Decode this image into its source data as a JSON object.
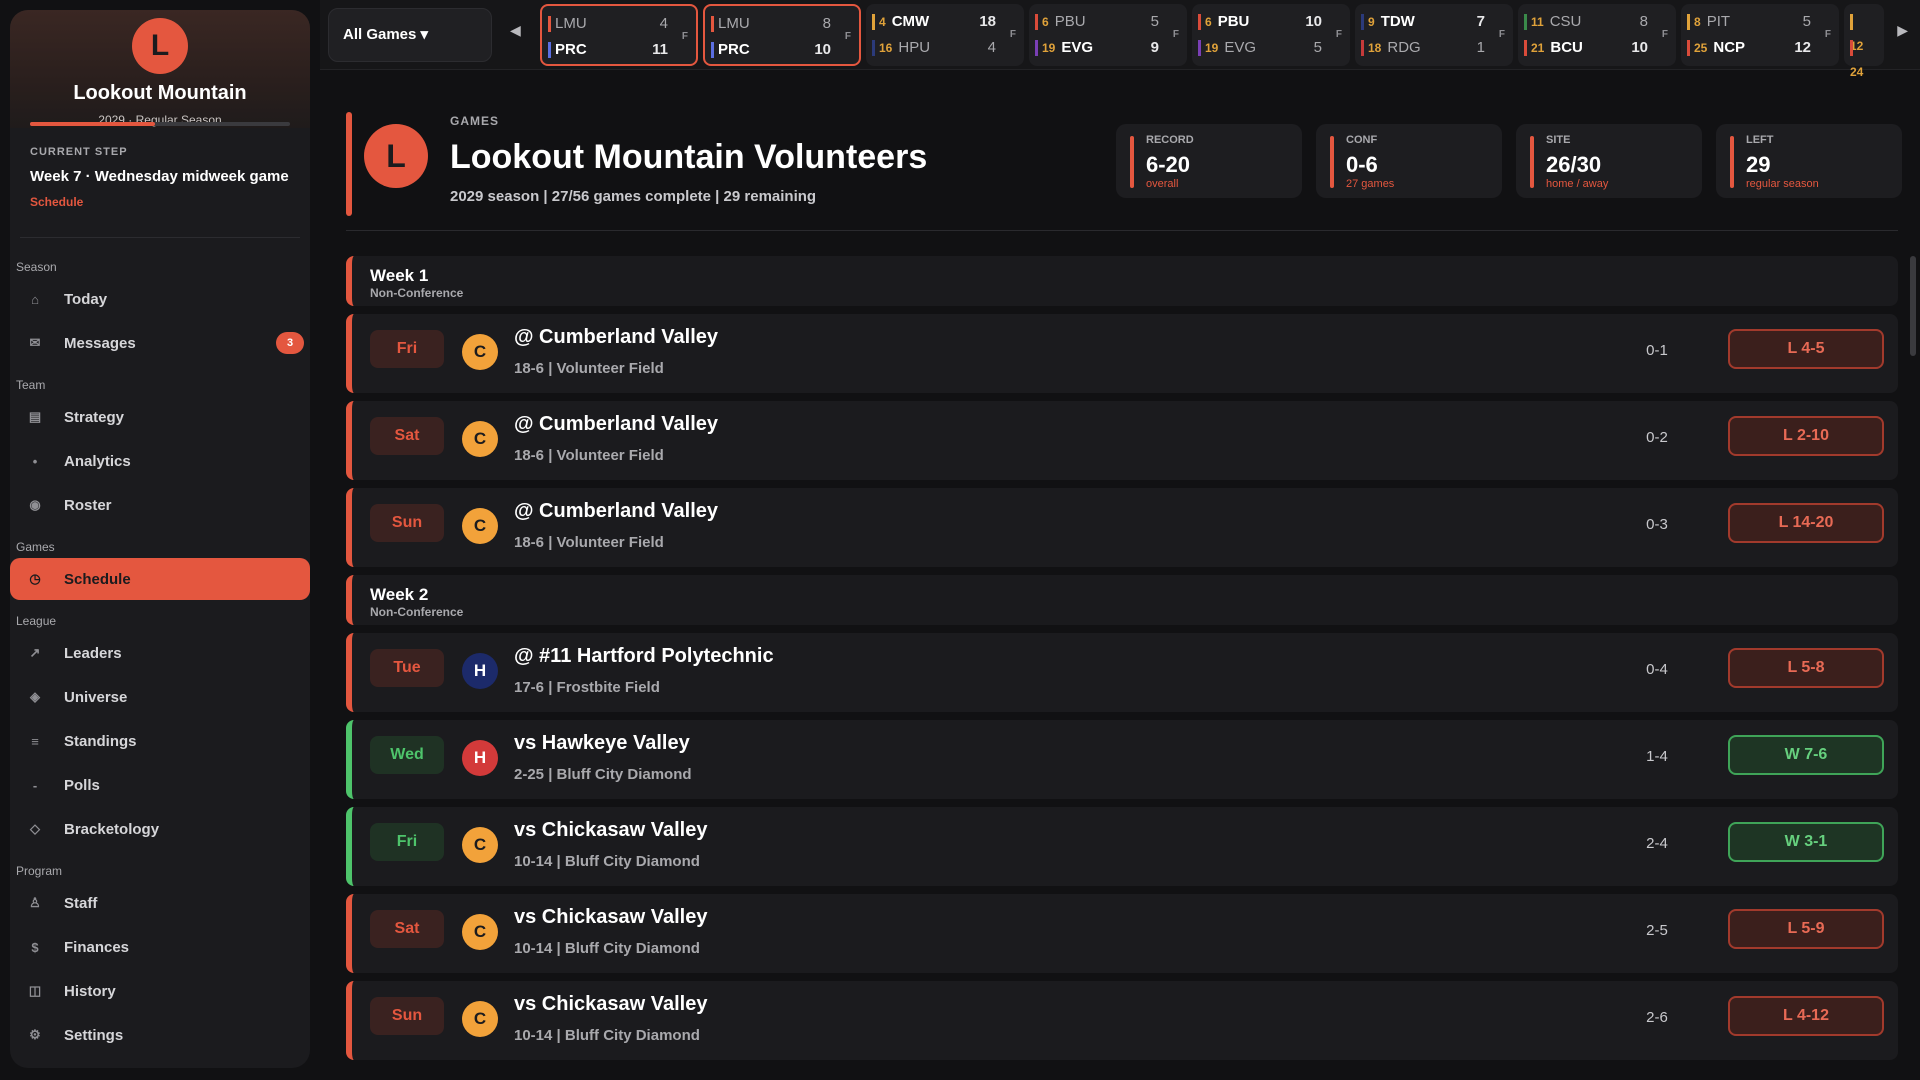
{
  "sidebar": {
    "team_logo_letter": "L",
    "team_name": "Lookout Mountain",
    "season_line": "2029 · Regular Season",
    "season_progress": 0.48,
    "current_step_label": "CURRENT STEP",
    "current_step_text": "Week 7 · Wednesday midweek game",
    "current_step_link": "Schedule",
    "groups": {
      "season": "Season",
      "team": "Team",
      "games": "Games",
      "league": "League",
      "program": "Program"
    },
    "items": {
      "today": "Today",
      "messages": "Messages",
      "messages_badge": "3",
      "strategy": "Strategy",
      "analytics": "Analytics",
      "roster": "Roster",
      "schedule": "Schedule",
      "leaders": "Leaders",
      "universe": "Universe",
      "standings": "Standings",
      "polls": "Polls",
      "bracketology": "Bracketology",
      "staff": "Staff",
      "finances": "Finances",
      "history": "History",
      "settings": "Settings"
    },
    "icons": {
      "today": "home-icon",
      "messages": "mail-icon",
      "strategy": "clipboard-icon",
      "analytics": "dot-icon",
      "roster": "circle-icon",
      "schedule": "clock-icon",
      "leaders": "arrow-up-right-icon",
      "universe": "diamond-icon",
      "standings": "list-icon",
      "polls": "dash-icon",
      "bracketology": "diamond-outline-icon",
      "staff": "person-icon",
      "finances": "dollar-icon",
      "history": "book-icon",
      "settings": "gear-icon"
    }
  },
  "ticker": {
    "filter_label": "All Games ▾",
    "games": [
      {
        "top": {
          "rank": "",
          "abbr": "LMU",
          "score": "4",
          "color": "#e4573f"
        },
        "bot": {
          "rank": "",
          "abbr": "PRC",
          "score": "11",
          "color": "#5b6ee1"
        },
        "status": "F",
        "highlight": true,
        "winner": "bot"
      },
      {
        "top": {
          "rank": "",
          "abbr": "LMU",
          "score": "8",
          "color": "#e4573f"
        },
        "bot": {
          "rank": "",
          "abbr": "PRC",
          "score": "10",
          "color": "#5b6ee1"
        },
        "status": "F",
        "highlight": true,
        "winner": "bot"
      },
      {
        "top": {
          "rank": "4",
          "abbr": "CMW",
          "score": "18",
          "color": "#e0a23a"
        },
        "bot": {
          "rank": "16",
          "abbr": "HPU",
          "score": "4",
          "color": "#2b3a7a"
        },
        "status": "F",
        "highlight": false,
        "winner": "top"
      },
      {
        "top": {
          "rank": "6",
          "abbr": "PBU",
          "score": "5",
          "color": "#d94b3a"
        },
        "bot": {
          "rank": "19",
          "abbr": "EVG",
          "score": "9",
          "color": "#7a3fb5"
        },
        "status": "F",
        "highlight": false,
        "winner": "bot"
      },
      {
        "top": {
          "rank": "6",
          "abbr": "PBU",
          "score": "10",
          "color": "#d94b3a"
        },
        "bot": {
          "rank": "19",
          "abbr": "EVG",
          "score": "5",
          "color": "#7a3fb5"
        },
        "status": "F",
        "highlight": false,
        "winner": "top"
      },
      {
        "top": {
          "rank": "9",
          "abbr": "TDW",
          "score": "7",
          "color": "#2b3a7a"
        },
        "bot": {
          "rank": "18",
          "abbr": "RDG",
          "score": "1",
          "color": "#c53a3a"
        },
        "status": "F",
        "highlight": false,
        "winner": "top"
      },
      {
        "top": {
          "rank": "11",
          "abbr": "CSU",
          "score": "8",
          "color": "#3a8a4a"
        },
        "bot": {
          "rank": "21",
          "abbr": "BCU",
          "score": "10",
          "color": "#d94b3a"
        },
        "status": "F",
        "highlight": false,
        "winner": "bot"
      },
      {
        "top": {
          "rank": "8",
          "abbr": "PIT",
          "score": "5",
          "color": "#e0a23a"
        },
        "bot": {
          "rank": "25",
          "abbr": "NCP",
          "score": "12",
          "color": "#d94b3a"
        },
        "status": "F",
        "highlight": false,
        "winner": "bot"
      },
      {
        "top": {
          "rank": "12",
          "abbr": "",
          "score": "",
          "color": "#e0a23a"
        },
        "bot": {
          "rank": "24",
          "abbr": "",
          "score": "",
          "color": "#d94b3a"
        },
        "status": "",
        "highlight": false,
        "winner": "top"
      }
    ]
  },
  "header": {
    "logo_letter": "L",
    "kicker": "GAMES",
    "title": "Lookout Mountain Volunteers",
    "subtitle": "2029 season | 27/56 games complete | 29 remaining",
    "stats": [
      {
        "label": "RECORD",
        "value": "6-20",
        "sub": "overall"
      },
      {
        "label": "CONF",
        "value": "0-6",
        "sub": "27 games"
      },
      {
        "label": "SITE",
        "value": "26/30",
        "sub": "home / away"
      },
      {
        "label": "LEFT",
        "value": "29",
        "sub": "regular season"
      }
    ]
  },
  "schedule": [
    {
      "type": "week",
      "title": "Week 1",
      "sub": "Non-Conference"
    },
    {
      "type": "game",
      "day": "Fri",
      "logo": "C",
      "logo_bg": "#f2a23a",
      "logo_fg": "#1b1b1e",
      "opponent": "@ Cumberland Valley",
      "meta": "18-6  |  Volunteer Field",
      "record": "0-1",
      "result": "L 4-5",
      "win": false
    },
    {
      "type": "game",
      "day": "Sat",
      "logo": "C",
      "logo_bg": "#f2a23a",
      "logo_fg": "#1b1b1e",
      "opponent": "@ Cumberland Valley",
      "meta": "18-6  |  Volunteer Field",
      "record": "0-2",
      "result": "L 2-10",
      "win": false
    },
    {
      "type": "game",
      "day": "Sun",
      "logo": "C",
      "logo_bg": "#f2a23a",
      "logo_fg": "#1b1b1e",
      "opponent": "@ Cumberland Valley",
      "meta": "18-6  |  Volunteer Field",
      "record": "0-3",
      "result": "L 14-20",
      "win": false
    },
    {
      "type": "week",
      "title": "Week 2",
      "sub": "Non-Conference"
    },
    {
      "type": "game",
      "day": "Tue",
      "logo": "H",
      "logo_bg": "#1c2a6a",
      "logo_fg": "#ffffff",
      "opponent": "@ #11 Hartford Polytechnic",
      "meta": "17-6  |  Frostbite Field",
      "record": "0-4",
      "result": "L 5-8",
      "win": false
    },
    {
      "type": "game",
      "day": "Wed",
      "logo": "H",
      "logo_bg": "#d33a3a",
      "logo_fg": "#ffffff",
      "opponent": "vs Hawkeye Valley",
      "meta": "2-25  |  Bluff City Diamond",
      "record": "1-4",
      "result": "W 7-6",
      "win": true
    },
    {
      "type": "game",
      "day": "Fri",
      "logo": "C",
      "logo_bg": "#f2a23a",
      "logo_fg": "#1b1b1e",
      "opponent": "vs Chickasaw Valley",
      "meta": "10-14  |  Bluff City Diamond",
      "record": "2-4",
      "result": "W 3-1",
      "win": true
    },
    {
      "type": "game",
      "day": "Sat",
      "logo": "C",
      "logo_bg": "#f2a23a",
      "logo_fg": "#1b1b1e",
      "opponent": "vs Chickasaw Valley",
      "meta": "10-14  |  Bluff City Diamond",
      "record": "2-5",
      "result": "L 5-9",
      "win": false
    },
    {
      "type": "game",
      "day": "Sun",
      "logo": "C",
      "logo_bg": "#f2a23a",
      "logo_fg": "#1b1b1e",
      "opponent": "vs Chickasaw Valley",
      "meta": "10-14  |  Bluff City Diamond",
      "record": "2-6",
      "result": "L 4-12",
      "win": false
    }
  ],
  "colors": {
    "accent": "#e4573f",
    "win": "#4ec46b",
    "loss": "#e86a55"
  }
}
